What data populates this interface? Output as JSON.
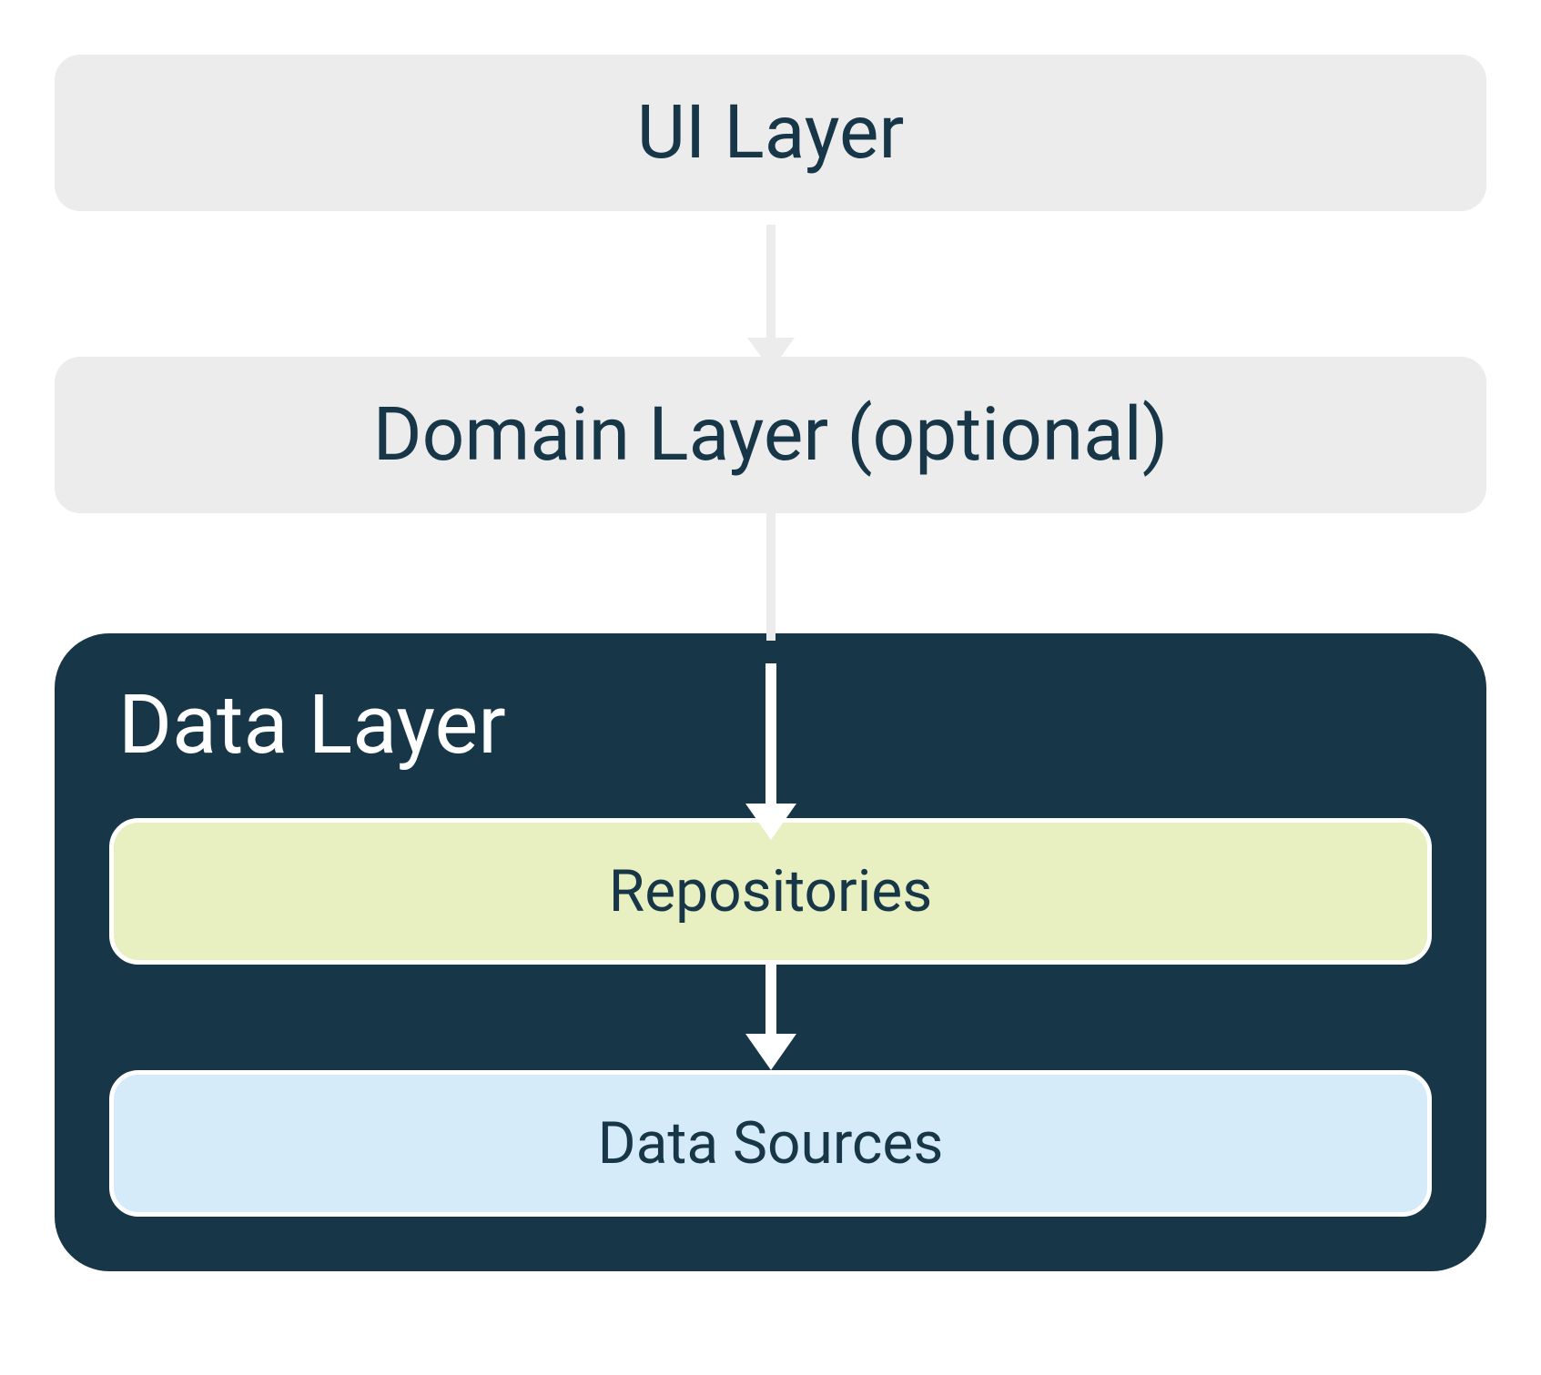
{
  "diagram": {
    "layers": {
      "ui": "UI Layer",
      "domain": "Domain Layer (optional)",
      "data": {
        "title": "Data Layer",
        "repositories": "Repositories",
        "data_sources": "Data Sources"
      }
    }
  },
  "colors": {
    "light_gray": "#ececec",
    "dark_navy": "#173647",
    "pale_yellow": "#e8efc0",
    "pale_blue": "#d6ebfa",
    "white": "#ffffff"
  }
}
